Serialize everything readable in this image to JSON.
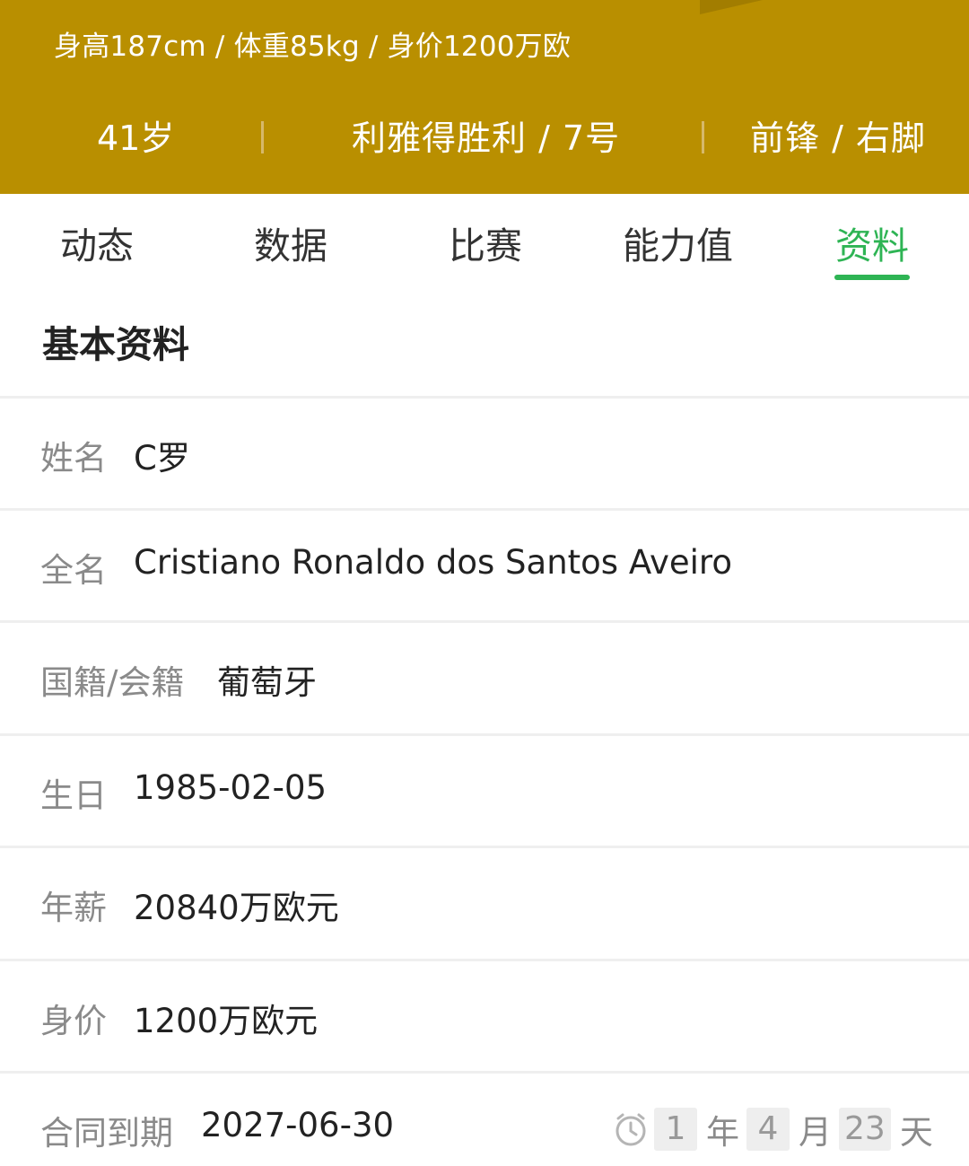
{
  "header": {
    "summary": "身高187cm / 体重85kg / 身价1200万欧",
    "age": "41岁",
    "club": "利雅得胜利 / 7号",
    "position": "前锋 / 右脚"
  },
  "tabs": [
    {
      "label": "动态"
    },
    {
      "label": "数据"
    },
    {
      "label": "比赛"
    },
    {
      "label": "能力值"
    },
    {
      "label": "资料",
      "active": true
    }
  ],
  "section": {
    "title": "基本资料"
  },
  "rows": [
    {
      "label": "姓名",
      "value": "C罗"
    },
    {
      "label": "全名",
      "value": "Cristiano Ronaldo dos Santos Aveiro"
    },
    {
      "label": "国籍/会籍",
      "value": "葡萄牙"
    },
    {
      "label": "生日",
      "value": "1985-02-05"
    },
    {
      "label": "年薪",
      "value": "20840万欧元"
    },
    {
      "label": "身价",
      "value": "1200万欧元"
    },
    {
      "label": "合同到期",
      "value": "2027-06-30"
    }
  ],
  "countdown": {
    "icon": "clock-icon",
    "years": "1",
    "years_unit": "年",
    "months": "4",
    "months_unit": "月",
    "days": "23",
    "days_unit": "天"
  },
  "colors": {
    "header_bg": "#b98f00",
    "accent_green": "#2eb454",
    "label_gray": "#8a8a8a"
  }
}
